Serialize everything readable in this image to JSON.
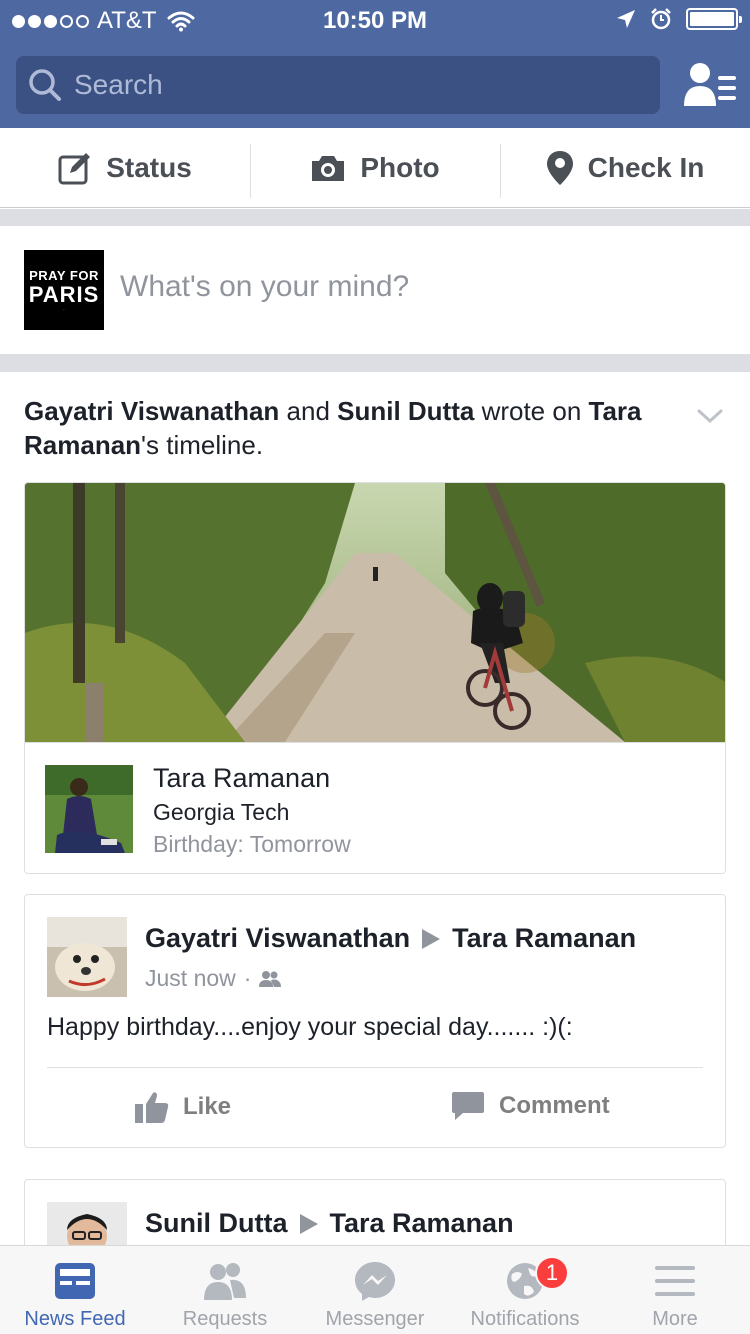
{
  "status_bar": {
    "carrier": "AT&T",
    "time": "10:50 PM",
    "signal_bars_filled": 3,
    "signal_bars_total": 5,
    "battery_level": 1.0
  },
  "search": {
    "placeholder": "Search"
  },
  "actions": [
    {
      "label": "Status",
      "icon": "edit-icon"
    },
    {
      "label": "Photo",
      "icon": "camera-icon"
    },
    {
      "label": "Check In",
      "icon": "location-pin-icon"
    }
  ],
  "composer": {
    "placeholder": "What's on your mind?",
    "profile_pic_text_1": "PRAY FOR",
    "profile_pic_text_2": "PARIS"
  },
  "story": {
    "author_1": "Gayatri Viswanathan",
    "joiner": " and ",
    "author_2": "Sunil Dutta",
    "action": " wrote on ",
    "target": "Tara Ramanan",
    "suffix": "'s timeline.",
    "birthday_card": {
      "name": "Tara Ramanan",
      "school": "Georgia Tech",
      "birthday": "Birthday: Tomorrow"
    },
    "posts": [
      {
        "author": "Gayatri Viswanathan",
        "target": "Tara Ramanan",
        "time": "Just now",
        "separator": "·",
        "text": "Happy birthday....enjoy your special day....... :)(:",
        "like_label": "Like",
        "comment_label": "Comment"
      },
      {
        "author": "Sunil Dutta",
        "target": "Tara Ramanan"
      }
    ]
  },
  "tabs": [
    {
      "label": "News Feed",
      "icon": "news-feed-icon",
      "active": true
    },
    {
      "label": "Requests",
      "icon": "friend-requests-icon"
    },
    {
      "label": "Messenger",
      "icon": "messenger-icon"
    },
    {
      "label": "Notifications",
      "icon": "globe-icon",
      "badge": "1"
    },
    {
      "label": "More",
      "icon": "menu-icon"
    }
  ],
  "colors": {
    "brand_blue": "#4e69a2",
    "search_bg": "#3b5083",
    "active_tab": "#4267b2",
    "badge_red": "#fa3e3e"
  }
}
